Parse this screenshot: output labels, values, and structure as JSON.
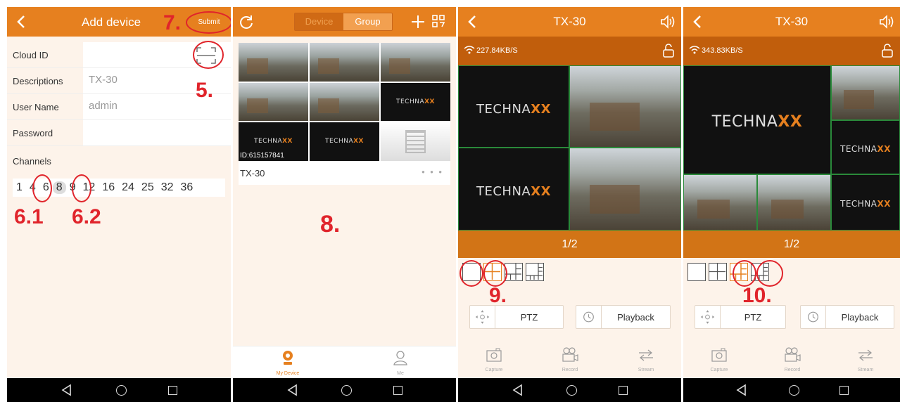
{
  "panel1": {
    "title": "Add device",
    "submit_label": "Submit",
    "fields": [
      {
        "label": "Cloud ID",
        "value": ""
      },
      {
        "label": "Descriptions",
        "value": "TX-30"
      },
      {
        "label": "User Name",
        "value": "admin"
      },
      {
        "label": "Password",
        "value": ""
      }
    ],
    "channels_label": "Channels",
    "channels": [
      "1",
      "4",
      "6",
      "8",
      "9",
      "12",
      "16",
      "24",
      "25",
      "32",
      "36"
    ]
  },
  "panel2": {
    "tabs": [
      "Device",
      "Group"
    ],
    "device_name": "TX-30",
    "device_id": "ID:615157841",
    "more": "• • •",
    "bottom_tabs": [
      "My Device",
      "Me"
    ]
  },
  "panel3": {
    "title": "TX-30",
    "speed": "227.84KB/S",
    "page": "1/2",
    "ptz_label": "PTZ",
    "playback_label": "Playback",
    "actions": [
      "Capture",
      "Record",
      "Stream"
    ]
  },
  "panel4": {
    "title": "TX-30",
    "speed": "343.83KB/S",
    "page": "1/2",
    "ptz_label": "PTZ",
    "playback_label": "Playback",
    "actions": [
      "Capture",
      "Record",
      "Stream"
    ]
  },
  "brand": {
    "pre": "TECHNA",
    "post": "XX"
  },
  "annotations": {
    "a5": "5.",
    "a61": "6.1",
    "a62": "6.2",
    "a7": "7.",
    "a8": "8.",
    "a9": "9.",
    "a10": "10."
  },
  "colors": {
    "accent": "#e6801f",
    "annotation": "#e0242b",
    "background": "#fdf3ea"
  }
}
